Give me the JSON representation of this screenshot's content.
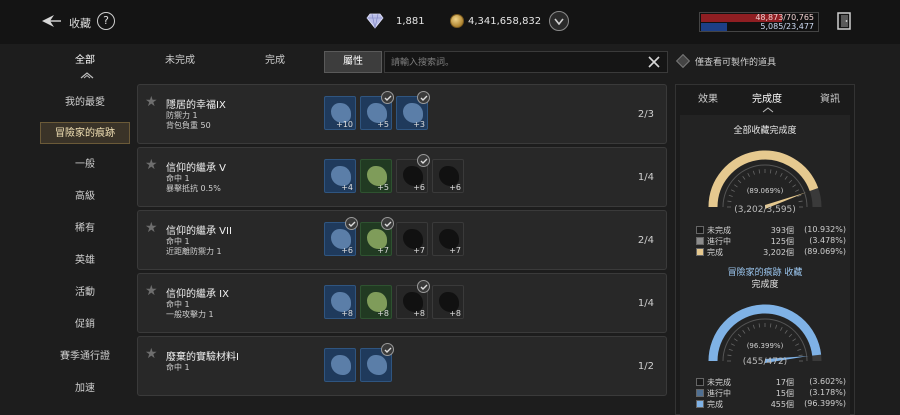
{
  "header": {
    "title": "收藏",
    "help": "?",
    "gems": "1,881",
    "gold": "4,341,658,832",
    "hp": "48,873/70,765",
    "hp_fraction": 0.69,
    "mp": "5,085/23,477",
    "mp_fraction": 0.22
  },
  "tabs": [
    {
      "label": "全部"
    },
    {
      "label": "未完成"
    },
    {
      "label": "完成"
    }
  ],
  "filter": {
    "attr_label": "屬性",
    "search_placeholder": "請輸入搜索詞。",
    "craftable_label": "僅查看可製作的道具"
  },
  "sidebar": [
    {
      "label": "我的最愛"
    },
    {
      "label": "冒險家的痕跡"
    },
    {
      "label": "一般"
    },
    {
      "label": "高級"
    },
    {
      "label": "稀有"
    },
    {
      "label": "英雄"
    },
    {
      "label": "活動"
    },
    {
      "label": "促銷"
    },
    {
      "label": "賽季通行證"
    },
    {
      "label": "加速"
    }
  ],
  "rows": [
    {
      "name": "隱居的幸福IX",
      "stats": [
        "防禦力 1",
        "背包負重 50"
      ],
      "progress": "2/3",
      "slots": [
        {
          "level": "+10",
          "color": "blue",
          "checked": false
        },
        {
          "level": "+5",
          "color": "blue",
          "checked": true
        },
        {
          "level": "+3",
          "color": "blue",
          "checked": true
        }
      ]
    },
    {
      "name": "信仰的繼承 V",
      "stats": [
        "命中 1",
        "暴擊抵抗 0.5%"
      ],
      "progress": "1/4",
      "slots": [
        {
          "level": "+4",
          "color": "blue",
          "checked": false
        },
        {
          "level": "+5",
          "color": "green",
          "checked": false
        },
        {
          "level": "+6",
          "color": "dark",
          "checked": true
        },
        {
          "level": "+6",
          "color": "dark",
          "checked": false
        }
      ]
    },
    {
      "name": "信仰的繼承 VII",
      "stats": [
        "命中 1",
        "近距離防禦力 1"
      ],
      "progress": "2/4",
      "slots": [
        {
          "level": "+6",
          "color": "blue",
          "checked": true
        },
        {
          "level": "+7",
          "color": "green",
          "checked": true
        },
        {
          "level": "+7",
          "color": "dark",
          "checked": false
        },
        {
          "level": "+7",
          "color": "dark",
          "checked": false
        }
      ]
    },
    {
      "name": "信仰的繼承 IX",
      "stats": [
        "命中 1",
        "一般攻擊力 1"
      ],
      "progress": "1/4",
      "slots": [
        {
          "level": "+8",
          "color": "blue",
          "checked": false
        },
        {
          "level": "+8",
          "color": "green",
          "checked": false
        },
        {
          "level": "+8",
          "color": "dark",
          "checked": true
        },
        {
          "level": "+8",
          "color": "dark",
          "checked": false
        }
      ]
    },
    {
      "name": "廢棄的實驗材料I",
      "stats": [
        "命中 1"
      ],
      "progress": "1/2",
      "slots": [
        {
          "level": "",
          "color": "blue",
          "checked": false
        },
        {
          "level": "",
          "color": "blue",
          "checked": true
        }
      ]
    }
  ],
  "panel": {
    "tabs": [
      {
        "label": "效果"
      },
      {
        "label": "完成度"
      },
      {
        "label": "資訊"
      }
    ],
    "overall": {
      "title": "全部收藏完成度",
      "percent": "(89.069%)",
      "fraction": 0.89069,
      "count": "(3,202/3,595)",
      "legend": [
        {
          "label": "未完成",
          "count": "393個",
          "pct": "(10.932%)",
          "color": "#1a1a1a"
        },
        {
          "label": "進行中",
          "count": "125個",
          "pct": "(3.478%)",
          "color": "#8c8c8c"
        },
        {
          "label": "完成",
          "count": "3,202個",
          "pct": "(89.069%)",
          "color": "#e6c98f"
        }
      ]
    },
    "adventure": {
      "title1": "冒險家的痕跡 收藏",
      "title2": "完成度",
      "percent": "(96.399%)",
      "fraction": 0.96399,
      "count": "(455/472)",
      "legend": [
        {
          "label": "未完成",
          "count": "17個",
          "pct": "(3.602%)",
          "color": "#1a1a1a"
        },
        {
          "label": "進行中",
          "count": "15個",
          "pct": "(3.178%)",
          "color": "#4f6f92"
        },
        {
          "label": "完成",
          "count": "455個",
          "pct": "(96.399%)",
          "color": "#7fb2e6"
        }
      ]
    }
  }
}
